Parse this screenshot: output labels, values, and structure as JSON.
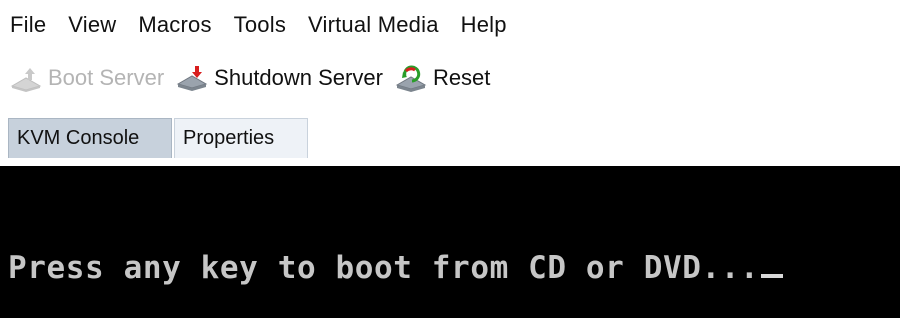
{
  "menubar": {
    "items": [
      {
        "label": "File"
      },
      {
        "label": "View"
      },
      {
        "label": "Macros"
      },
      {
        "label": "Tools"
      },
      {
        "label": "Virtual Media"
      },
      {
        "label": "Help"
      }
    ]
  },
  "toolbar": {
    "boot_server": {
      "label": "Boot Server",
      "icon": "boot-server-icon",
      "enabled": false
    },
    "shutdown_server": {
      "label": "Shutdown Server",
      "icon": "shutdown-server-icon",
      "enabled": true
    },
    "reset": {
      "label": "Reset",
      "icon": "reset-icon",
      "enabled": true
    }
  },
  "tabs": [
    {
      "label": "KVM Console",
      "active": true
    },
    {
      "label": "Properties",
      "active": false
    }
  ],
  "console": {
    "text": "Press any key to boot from CD or DVD..."
  },
  "colors": {
    "console_bg": "#000000",
    "console_text": "#c6c6c6",
    "active_tab_bg": "#c7d1dc",
    "inactive_tab_bg": "#eef2f7",
    "disabled_text": "#b4b4b4"
  }
}
